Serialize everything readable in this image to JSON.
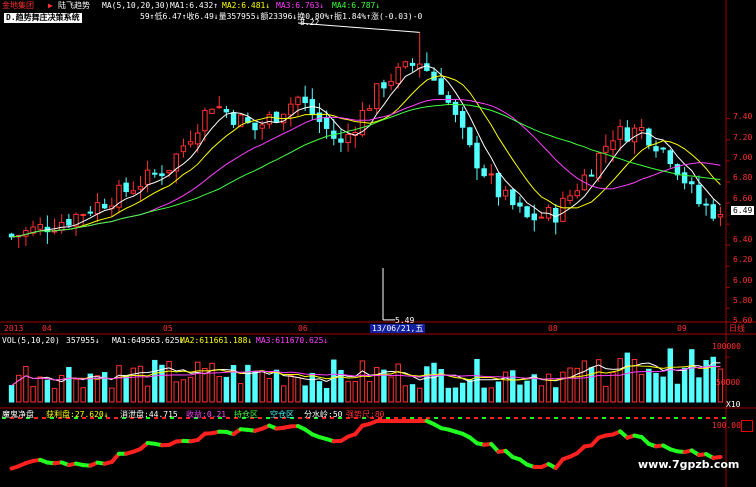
{
  "header": {
    "stock_name": "金地集团",
    "indicator_name": "陆飞趋势",
    "ma_params": "MA(5,10,20,30)",
    "ma1": "MA1:6.432↑",
    "ma2": "MA2:6.481↓",
    "ma3": "MA3:6.763↓",
    "ma4": "MA4:6.787↓",
    "info_line": "59↑低6.47↑收6.49↓量357955↓额23396↓换0.80%↑振1.84%↑涨(-0.03)-0",
    "strategy_tag": "D.趋势舞庄决策系统",
    "high_annot": "8.22"
  },
  "main": {
    "low_annot": "5.49",
    "price_tag": "6.49",
    "cursor_date": "13/06/21,五",
    "time_labels": [
      "2013",
      "04",
      "05",
      "06",
      "08",
      "09"
    ],
    "period_label": "日线"
  },
  "vol": {
    "title": "VOL(5,10,20)",
    "vol": "357955↓",
    "ma1": "MA1:649563.625↓",
    "ma2": "MA2:611661.188↓",
    "ma3": "MA3:611670.625↓",
    "x10": "X10"
  },
  "ind": {
    "title": "魔鬼净盘",
    "profit": "获利盘:27.620↓",
    "trapped": "消泄盘:44.715",
    "harvest": "收益:0.21",
    "zone1": "持仓区",
    "zone2": "空仓区",
    "watershed": "分水岭:50",
    "red_ruler": "强势尺:80"
  },
  "watermark": "www.7gpzb.com",
  "chart_data": [
    {
      "type": "candlestick",
      "y_ticks": [
        5.6,
        5.8,
        6.0,
        6.2,
        6.4,
        6.6,
        6.8,
        7.0,
        7.2,
        7.4
      ],
      "ylim": [
        5.47,
        8.3
      ],
      "bars": 100,
      "marked_high": 8.22,
      "marked_low": 5.49,
      "last_close": 6.49,
      "colors": {
        "up": "#ff3030",
        "down": "#54ffff",
        "ma5": "#ffffff",
        "ma10": "#ffff00",
        "ma20": "#ff40ff",
        "ma30": "#40ff40"
      }
    },
    {
      "type": "bar",
      "title": "VOL(5,10,20)",
      "y_ticks": [
        50000,
        100000
      ],
      "ylim": [
        0,
        125000
      ],
      "unit": "X10",
      "colors": {
        "up": "#ff3030",
        "down": "#54ffff"
      }
    },
    {
      "type": "line",
      "title": "魔鬼净盘",
      "y_ticks": [
        100.0
      ],
      "ylim": [
        0,
        100
      ],
      "colors": {
        "rising": "#ff2020",
        "falling": "#20ff20"
      }
    }
  ],
  "tick_labels": {
    "price": [
      "7.40",
      "7.20",
      "7.00",
      "6.80",
      "6.60",
      "6.40",
      "6.20",
      "6.00",
      "5.80",
      "5.60"
    ],
    "vol": [
      "100000",
      "50000"
    ],
    "ind": [
      "100.00"
    ]
  }
}
